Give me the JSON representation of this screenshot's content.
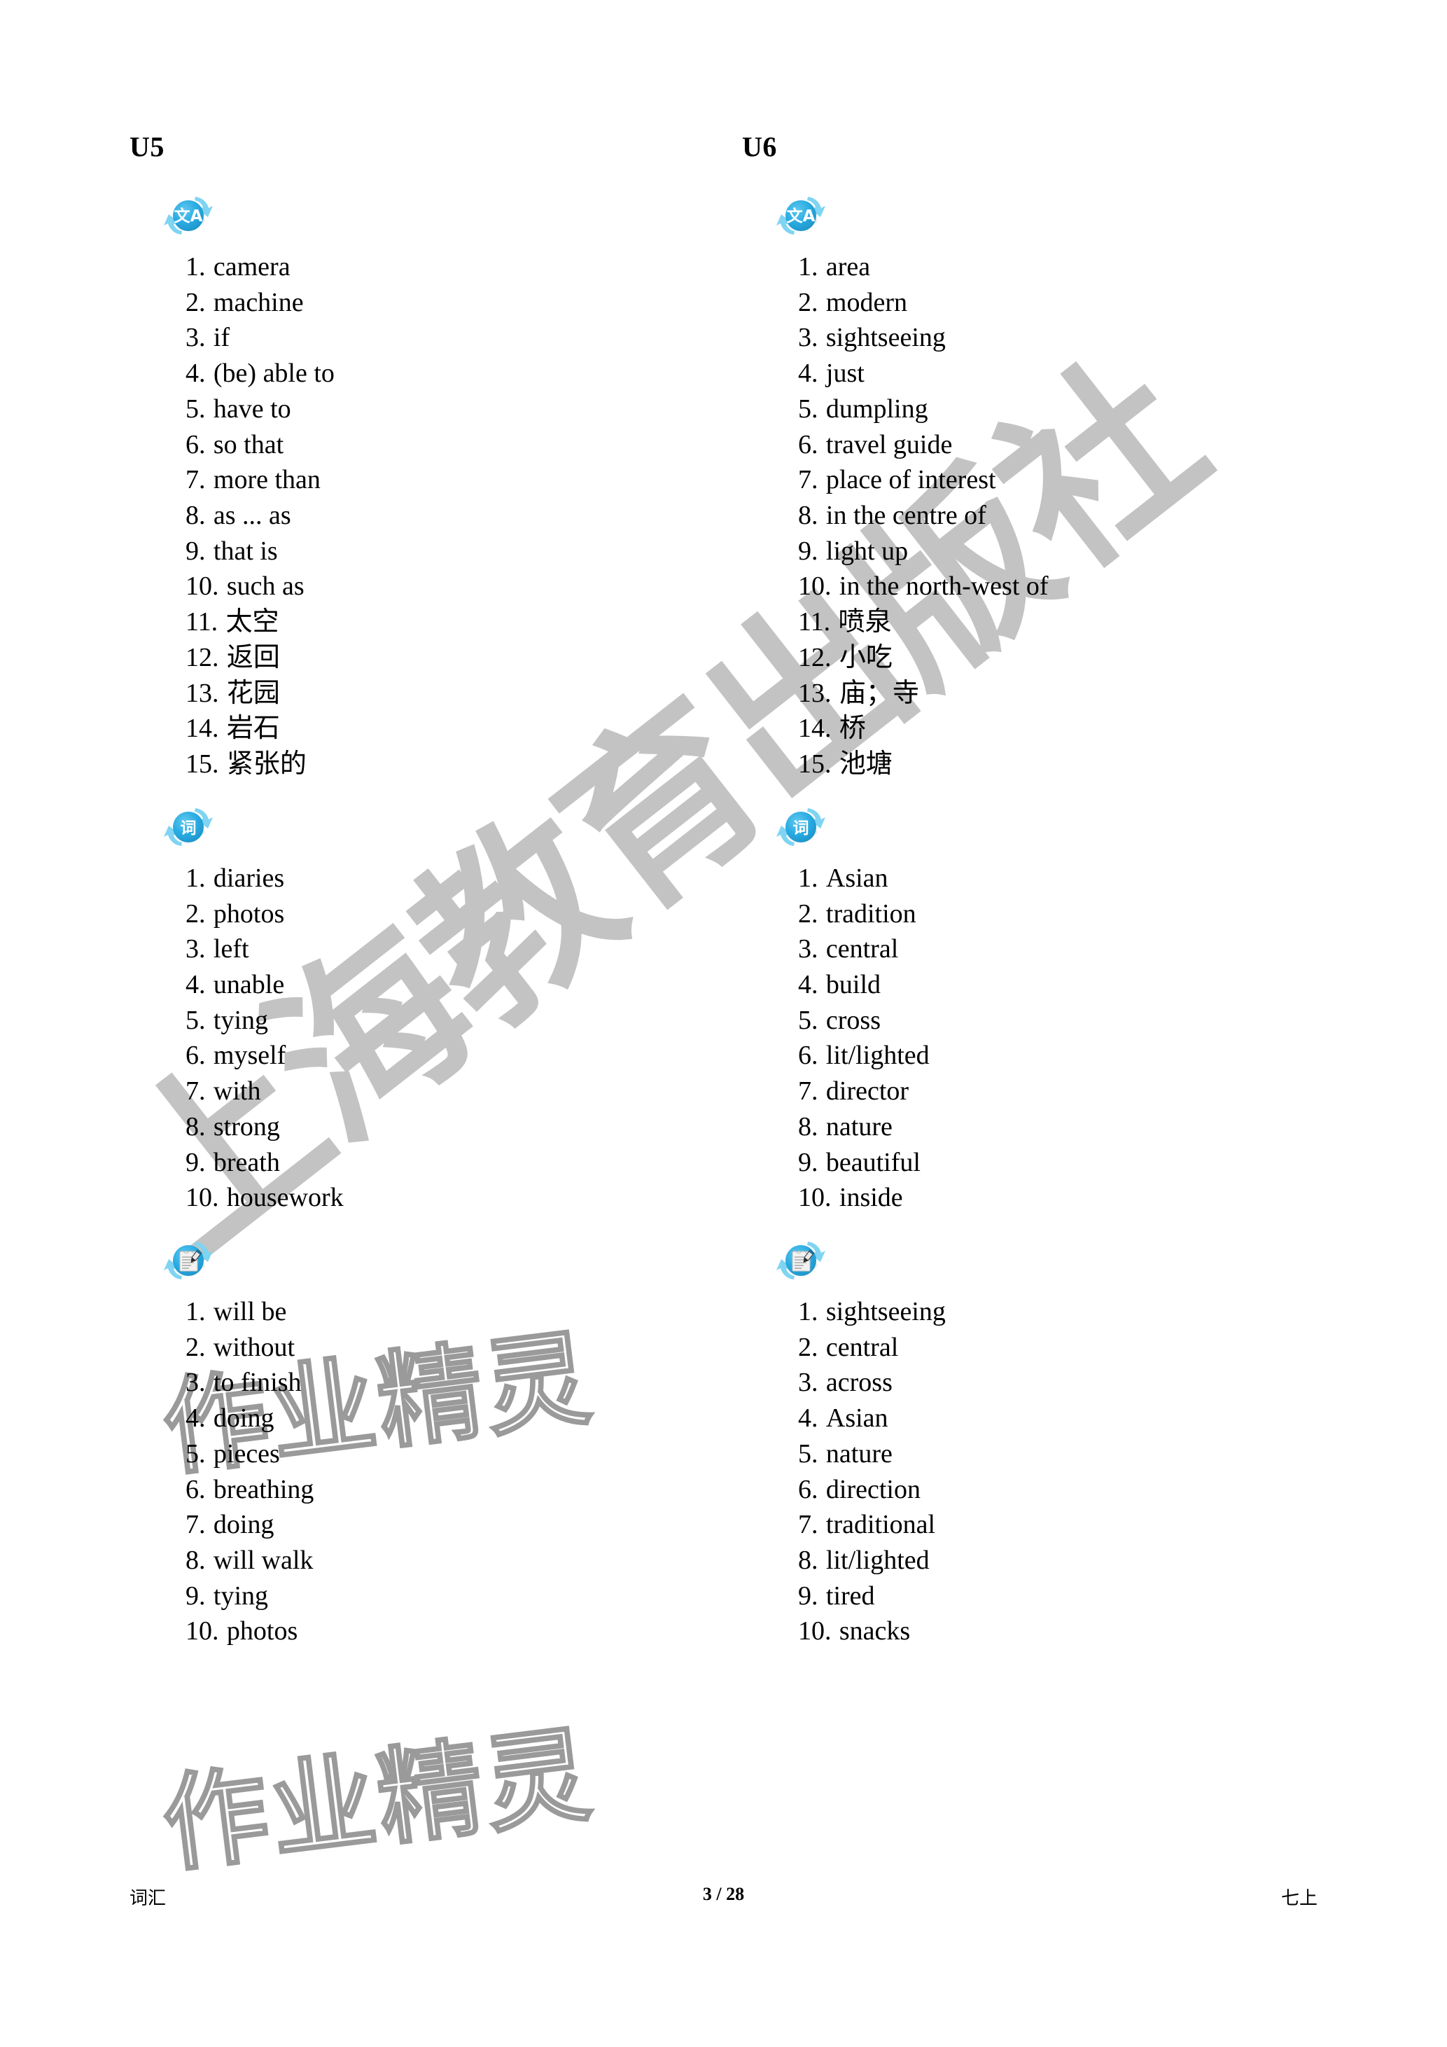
{
  "watermarks": {
    "diagonal": "上海教育出版社",
    "outline": "作业精灵"
  },
  "colors": {
    "icon_blue": "#29abe2",
    "icon_arrow_blue": "#7fd4f2",
    "watermark_gray": "#c3c3c3",
    "outline_gray": "#9a9a9a"
  },
  "columns": [
    {
      "title": "U5",
      "sections": [
        {
          "icon": "translate-icon",
          "icon_glyph": "文A",
          "items": [
            "camera",
            "machine",
            "if",
            "(be) able to",
            "have to",
            "so that",
            "more than",
            "as ... as",
            "that is",
            "such as",
            "太空",
            "返回",
            "花园",
            "岩石",
            "紧张的"
          ]
        },
        {
          "icon": "word-icon",
          "icon_glyph": "词",
          "items": [
            "diaries",
            "photos",
            "left",
            "unable",
            "tying",
            "myself",
            "with",
            "strong",
            "breath",
            "housework"
          ]
        },
        {
          "icon": "notepad-pencil-icon",
          "icon_glyph": "",
          "items": [
            "will be",
            "without",
            "to finish",
            "doing",
            "pieces",
            "breathing",
            "doing",
            "will walk",
            "tying",
            "photos"
          ]
        }
      ]
    },
    {
      "title": "U6",
      "sections": [
        {
          "icon": "translate-icon",
          "icon_glyph": "文A",
          "items": [
            "area",
            "modern",
            "sightseeing",
            "just",
            "dumpling",
            "travel guide",
            "place of interest",
            "in the centre of",
            "light up",
            "in the north-west of",
            "喷泉",
            "小吃",
            "庙；寺",
            "桥",
            "池塘"
          ]
        },
        {
          "icon": "word-icon",
          "icon_glyph": "词",
          "items": [
            "Asian",
            "tradition",
            "central",
            "build",
            "cross",
            "lit/lighted",
            "director",
            "nature",
            "beautiful",
            "inside"
          ]
        },
        {
          "icon": "notepad-pencil-icon",
          "icon_glyph": "",
          "items": [
            "sightseeing",
            "central",
            "across",
            "Asian",
            "nature",
            "direction",
            "traditional",
            "lit/lighted",
            "tired",
            "snacks"
          ]
        }
      ]
    }
  ],
  "footer": {
    "left": "词汇",
    "center": "3 / 28",
    "right": "七上"
  }
}
